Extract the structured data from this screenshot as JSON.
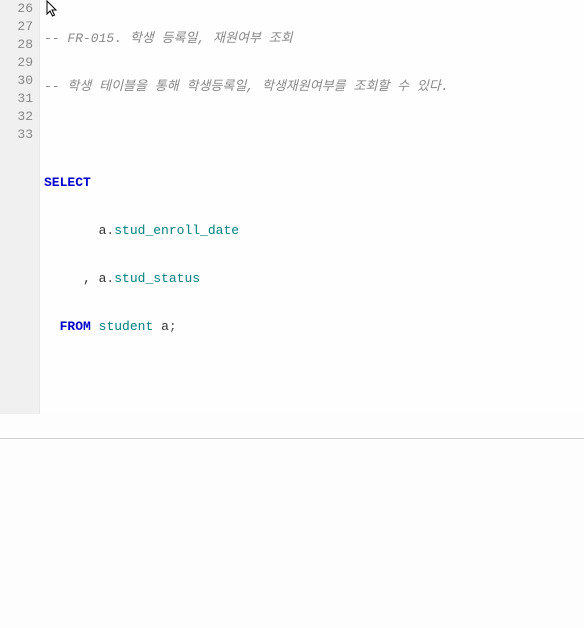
{
  "lines": {
    "n26": "26",
    "n27": "27",
    "n28": "28",
    "n29": "29",
    "n30": "30",
    "n31": "31",
    "n32": "32",
    "n33": "33"
  },
  "code": {
    "l26": "-- FR-015. 학생 등록일, 재원여부 조회",
    "l27": "-- 학생 테이블을 통해 학생등록일, 학생재원여부를 조회할 수 있다.",
    "l29_kw": "SELECT",
    "l30_pre": "       ",
    "l30_id1": "a",
    "l30_dot": ".",
    "l30_id2": "stud_enroll_date",
    "l31_pre": "     , ",
    "l31_id1": "a",
    "l31_dot": ".",
    "l31_id2": "stud_status",
    "l32_pre": "  ",
    "l32_kw": "FROM",
    "l32_sp": " ",
    "l32_tbl": "student",
    "l32_sp2": " ",
    "l32_alias": "a",
    "l32_semi": ";"
  }
}
